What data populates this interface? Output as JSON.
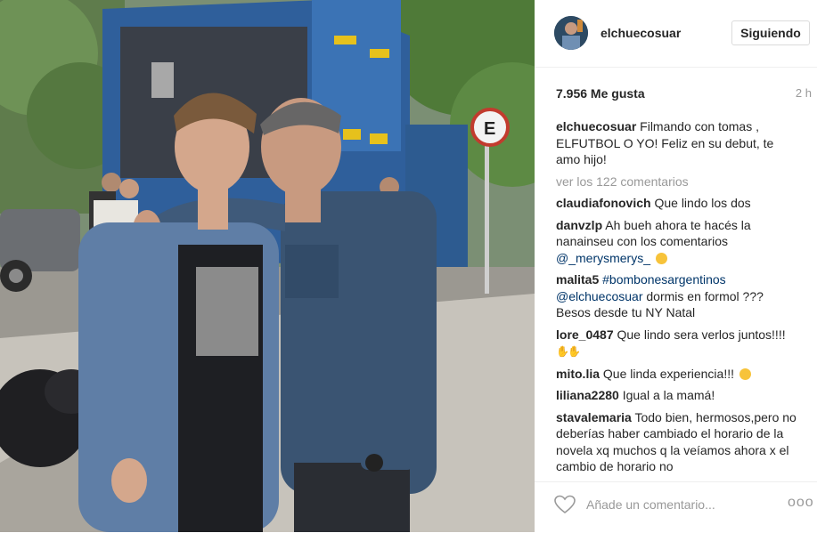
{
  "post": {
    "username": "elchuecosuar",
    "follow_label": "Siguiendo",
    "likes": "7.956 Me gusta",
    "time": "2 h",
    "caption": {
      "user": "elchuecosuar",
      "text": "Filmando con tomas , ELFUTBOL O YO! Feliz en su debut, te amo hijo!"
    },
    "view_all": "ver los 122 comentarios",
    "comments": [
      {
        "user": "claudiafonovich",
        "text": "Que lindo los dos"
      },
      {
        "user": "danvzlp",
        "text": "Ah bueh ahora te hacés la nanainseu con los comentarios",
        "mention": "@_merysmerys_"
      },
      {
        "user": "malita5",
        "hashtag": "#bombonesargentinos",
        "mention": "@elchuecosuar",
        "text": "dormis en formol ??? Besos desde tu NY Natal"
      },
      {
        "user": "lore_0487",
        "text": "Que lindo sera verlos juntos!!!!"
      },
      {
        "user": "mito.lia",
        "text": "Que linda experiencia!!!"
      },
      {
        "user": "liliana2280",
        "text": "Igual a la mamá!"
      },
      {
        "user": "stavalemaria",
        "text": "Todo bien, hermosos,pero no deberías haber cambiado el horario de la novela xq muchos q la veíamos ahora x el cambio de horario no"
      }
    ],
    "comment_placeholder": "Añade un comentario...",
    "more_label": "ooo"
  },
  "photo": {
    "sign_text": "E"
  },
  "icons": {
    "heart": "heart-outline-icon",
    "more": "more-options-icon"
  },
  "colors": {
    "link": "#003569",
    "muted": "#999999",
    "border": "#efefef"
  }
}
